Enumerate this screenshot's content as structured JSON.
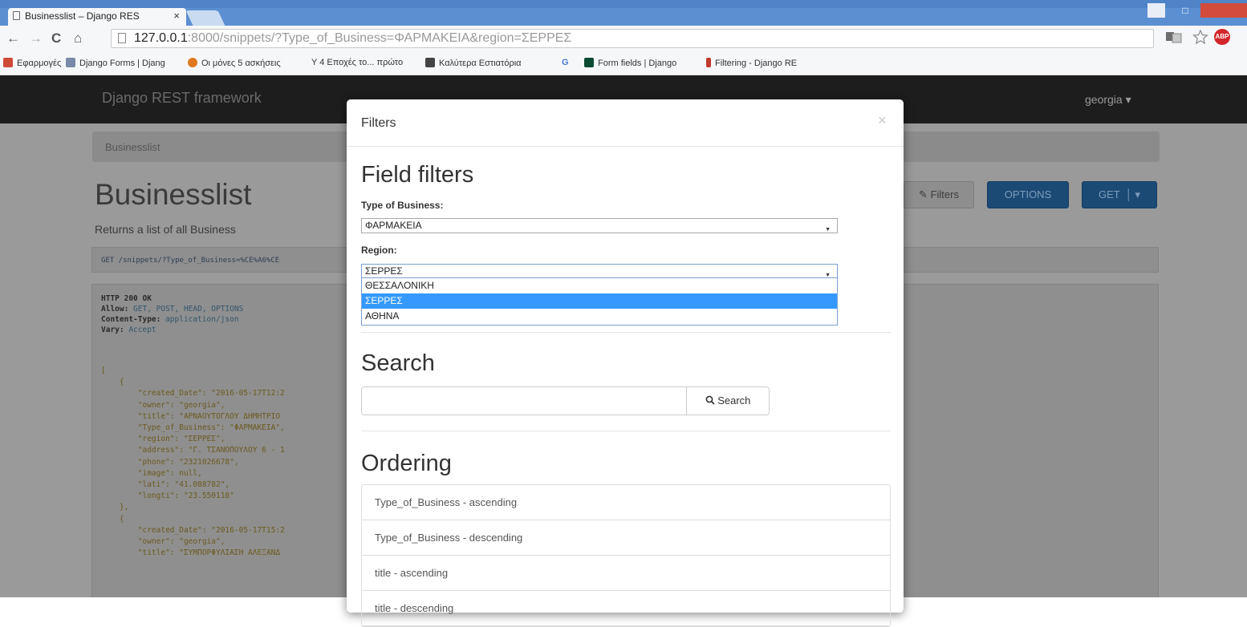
{
  "browser": {
    "tab_title": "Businesslist – Django RES",
    "tab_close": "×",
    "url_host": "127.0.0.1",
    "url_rest": ":8000/snippets/?Type_of_Business=ΦΑΡΜΑΚΕΙΑ&region=ΣΕΡΡΕΣ",
    "nav": {
      "back": "←",
      "forward": "→",
      "reload": "C",
      "home": "⌂"
    },
    "window_max": "□",
    "ext_abp": "ABP",
    "bookmarks": [
      {
        "label": "Εφαρμογές",
        "color": "#d04a3a"
      },
      {
        "label": "Django Forms | Djang",
        "color": "#7a8aa8"
      },
      {
        "label": "Οι μόνες 5 ασκήσεις",
        "color": "#e07a1f"
      },
      {
        "label": "Y  4 Εποχές το... πρώτο",
        "color": "#6b2f8f"
      },
      {
        "label": "Καλύτερα Εστιατόρια",
        "color": "#444444"
      },
      {
        "label": "G",
        "color": "#4a7ad3"
      },
      {
        "label": "Form fields | Django",
        "color": "#0c4b33"
      },
      {
        "label": "Filtering - Django RE",
        "color": "#c0392b"
      }
    ]
  },
  "page": {
    "brand": "Django REST framework",
    "user": "georgia ▾",
    "breadcrumb": "Businesslist",
    "title": "Businesslist",
    "description": "Returns a list of all Business",
    "request_line": "GET  /snippets/?Type_of_Business=%CE%A6%CE",
    "buttons": {
      "filters": "Filters",
      "options": "OPTIONS",
      "get": "GET"
    },
    "response_lines": [
      {
        "key": "HTTP 200 OK",
        "val": ""
      },
      {
        "key": "Allow: ",
        "val": "GET, POST, HEAD, OPTIONS"
      },
      {
        "key": "Content-Type: ",
        "val": "application/json"
      },
      {
        "key": "Vary: ",
        "val": "Accept"
      }
    ],
    "json_lines": [
      "[",
      "    {",
      "        \"created_Date\": \"2016-05-17T12:2",
      "        \"owner\": \"georgia\",",
      "        \"title\": \"ΑΡΝΑΟΥΤΟΓΛΟΥ ΔΗΜΗΤΡΙΟ",
      "        \"Type_of_Business\": \"ΦΑΡΜΑΚΕΙΑ\",",
      "        \"region\": \"ΣΕΡΡΕΣ\",",
      "        \"address\": \"Γ. ΤΣΑΝΟΠΟΥΛΟΥ 6 - 1",
      "        \"phone\": \"2321026678\",",
      "        \"image\": null,",
      "        \"lati\": \"41.088782\",",
      "        \"longti\": \"23.550118\"",
      "    },",
      "    {",
      "        \"created_Date\": \"2016-05-17T15:2",
      "        \"owner\": \"georgia\",",
      "        \"title\": \"ΣΥΜΠΟΡΦΥΛΙΑΣΗ ΑΛΕΞΑΝΔ"
    ]
  },
  "modal": {
    "title": "Filters",
    "close": "×",
    "field_filters_heading": "Field filters",
    "type_label": "Type of Business:",
    "type_value": "ΦΑΡΜΑΚΕΙΑ",
    "region_label": "Region:",
    "region_value": "ΣΕΡΡΕΣ",
    "region_options": [
      "ΘΕΣΣΑΛΟΝΙΚΗ",
      "ΣΕΡΡΕΣ",
      "ΑΘΗΝΑ"
    ],
    "region_selected_index": 1,
    "search_heading": "Search",
    "search_value": "",
    "search_button": "Search",
    "ordering_heading": "Ordering",
    "ordering_items": [
      "Type_of_Business - ascending",
      "Type_of_Business - descending",
      "title - ascending",
      "title - descending"
    ]
  },
  "colors": {
    "chrome_blue": "#5b8fd1",
    "navbar": "#1d1d1d",
    "primary_button": "#1b4a75",
    "dropdown_highlight": "#3399ff",
    "close_red": "#d24b3c"
  }
}
